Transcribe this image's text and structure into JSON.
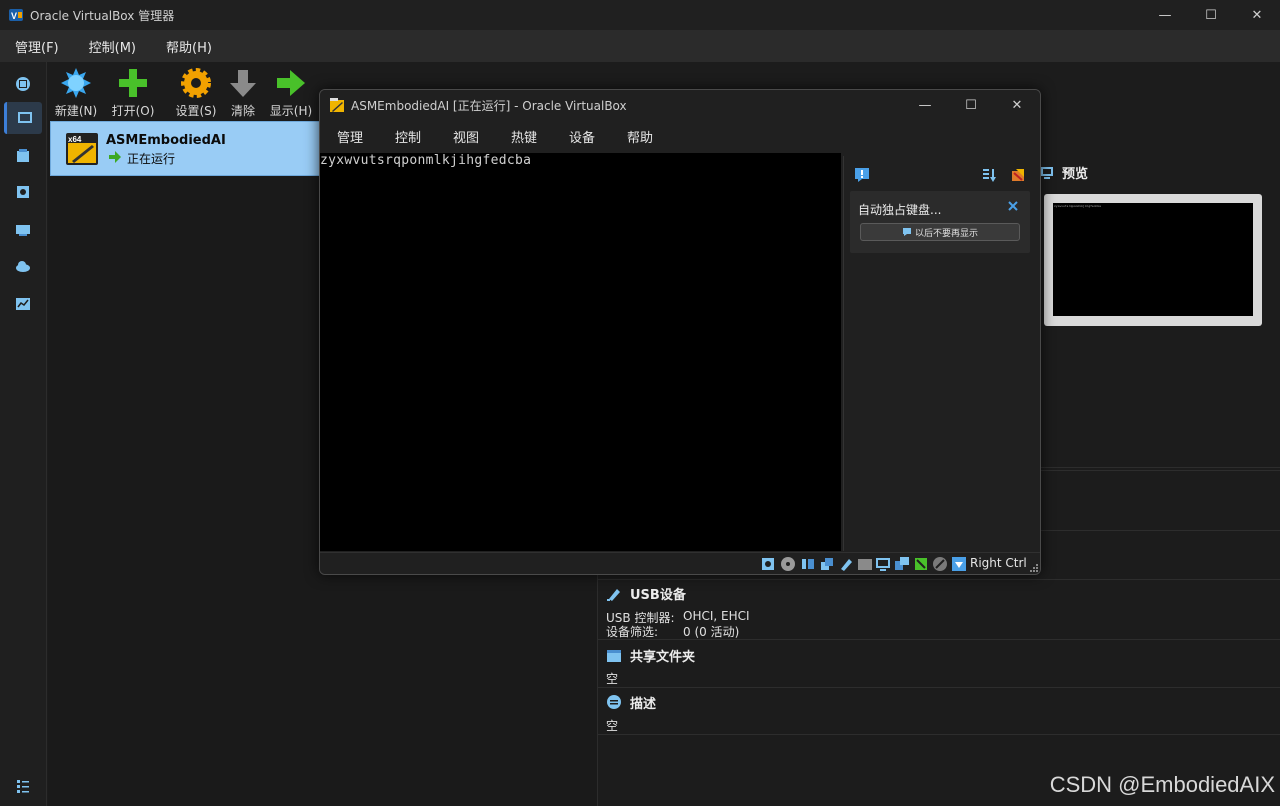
{
  "manager": {
    "title": "Oracle VirtualBox 管理器",
    "window_controls": {
      "minimize": "—",
      "maximize": "☐",
      "close": "✕"
    },
    "menu": [
      "管理(F)",
      "控制(M)",
      "帮助(H)"
    ],
    "toolbar": {
      "new_label": "新建(N)",
      "open_label": "打开(O)",
      "settings_label": "设置(S)",
      "discard_label": "清除",
      "show_label": "显示(H)"
    },
    "vm_list": [
      {
        "name": "ASMEmbodiedAI",
        "state": "正在运行",
        "os_badge": "x64"
      }
    ],
    "details": {
      "preview_title": "预览",
      "preview_text": "zyxwvutsrqponmlkjihgfedcba",
      "usb": {
        "title": "USB设备",
        "controller_key": "USB 控制器:",
        "controller_value": "OHCI, EHCI",
        "filters_key": "设备筛选:",
        "filters_value": "0 (0 活动)"
      },
      "shared_folders": {
        "title": "共享文件夹",
        "value": "空"
      },
      "description": {
        "title": "描述",
        "value": "空"
      }
    }
  },
  "vm_window": {
    "title": "ASMEmbodiedAI [正在运行] - Oracle VirtualBox",
    "window_controls": {
      "minimize": "—",
      "maximize": "☐",
      "close": "✕"
    },
    "menu": [
      "管理",
      "控制",
      "视图",
      "热键",
      "设备",
      "帮助"
    ],
    "console_text": "zyxwvutsrqponmlkjihgfedcba",
    "notice": {
      "text": "自动独占键盘...",
      "button_label": "以后不要再显示"
    },
    "host_key": "Right Ctrl"
  },
  "watermark": "CSDN @EmbodiedAIX",
  "colors": {
    "selection": "#99ccf5",
    "accent": "#3d7fd8",
    "background": "#1c1c1c"
  }
}
